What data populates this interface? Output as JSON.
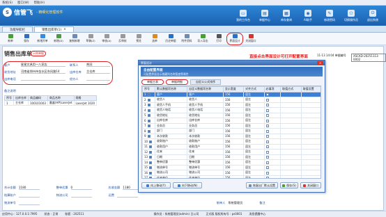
{
  "menu": [
    "系统(S)",
    "窗口(W)",
    "帮助(H)"
  ],
  "brand": {
    "logo_glyph": "S",
    "name": "信管飞",
    "tagline": "- 精细化管理软件"
  },
  "topnav": [
    {
      "label": "我的工作台",
      "glyph": "▭"
    },
    {
      "label": "单据中心",
      "glyph": "▤"
    },
    {
      "label": "库存查询",
      "glyph": "▦"
    },
    {
      "label": "AI助手",
      "glyph": "◉"
    },
    {
      "label": "修改密码",
      "glyph": "✎"
    },
    {
      "label": "切换操作员",
      "glyph": "⚇"
    },
    {
      "label": "退出系统",
      "glyph": "⏻"
    }
  ],
  "doctabs": [
    {
      "label": "功能导航栏",
      "active": false
    },
    {
      "label": "销售出库单(1)",
      "active": true
    }
  ],
  "toolbar": [
    {
      "label": "新单",
      "color": "#4b9c3a"
    },
    {
      "label": "保存",
      "color": "#2f6fbf"
    },
    {
      "label": "新增开单",
      "color": "#3b8ad9"
    },
    {
      "label": "新增(D)",
      "color": "#4b9c3a"
    },
    {
      "label": "复制新增",
      "color": "#6d8bb3"
    },
    {
      "label": "草稿(Z)",
      "color": "#999999"
    },
    {
      "label": "审核(A)",
      "color": "#999999"
    },
    {
      "label": "反审核",
      "color": "#999999"
    },
    {
      "label": "预览",
      "color": "#999999"
    },
    {
      "label": "选单",
      "color": "#e08a1e"
    },
    {
      "label": "历史单据",
      "color": "#2f6fbf"
    },
    {
      "label": "附件资料",
      "color": "#6d8bb3"
    },
    {
      "label": "导入导出",
      "color": "#4b9c3a"
    },
    {
      "label": "打印",
      "color": "#555555"
    },
    {
      "label": "界面设计",
      "color": "#2f6fbf"
    },
    {
      "label": "关闭窗口",
      "color": "#d9342b"
    }
  ],
  "form": {
    "title": "销售出库单",
    "sample_tag": "示例单据",
    "customer_label": "客户",
    "customer_value": "星星文具用一八家店",
    "address_label": "收货地址",
    "address_value": "河南省郑州市金水区东风路14",
    "contact_label": "联系人",
    "contact_value": "胡冠",
    "phone_label": "出库电话",
    "warehouse_label": "出库仓库",
    "warehouse_value": "主仓库",
    "agent_label": "经办人",
    "note_label": "备注说明",
    "lines_headers": [
      "序号",
      "出库仓库",
      "商品编码",
      "商品名称",
      "规格"
    ],
    "lines": [
      [
        "1",
        "主仓库",
        "100101003",
        "墨盒(HP)LaserJet",
        "LaserJet 1020"
      ]
    ]
  },
  "annotation": "直接点击界面设计可打开配置界面",
  "date_text": "11-13 14:04",
  "doc_no_label": "单据编号",
  "doc_no": "XSCKD-20251113-0002",
  "summary": {
    "qty_label": "合计金额",
    "qty_value": "1180",
    "disc_label": "整单优惠",
    "disc_value": "0",
    "paid_label": "应收金额",
    "paid_value": "1180",
    "recv_label": "结算账户",
    "ship_label": "物流公司",
    "trk_label": "物流单号",
    "fee_label": "运费",
    "maker_label": "制单人",
    "maker_value": "系统管理员",
    "remark_label": "备注"
  },
  "status": {
    "ip": "应用中心 : 127.0.0.1:7995",
    "state": "状态 : 正常",
    "count": "账套 : 202511",
    "operator": "操作员 : 系统管理员(admin) 日公司",
    "version": "正式版 版权所有号 : ps0001",
    "online": "消息提醒中心"
  },
  "dialog": {
    "window_title": "界面设计",
    "head_title": "自由配置界面",
    "head_sub": "可配置界面显示隐藏列名称宽度等属性",
    "tabs": [
      {
        "label": "单据主表",
        "selected": true
      },
      {
        "label": "单据明细",
        "selected": true
      },
      {
        "label": "自定义公式排序",
        "selected": false
      }
    ],
    "headers": [
      "序号",
      "默认数据项名称",
      "自定义数据项名称",
      "显示宽度",
      "对齐方式",
      "必填项",
      "取值方式",
      "取值设置"
    ],
    "rows": [
      [
        "1",
        "客户",
        "客户",
        "156",
        "居左"
      ],
      [
        "2",
        "收货人",
        "收货人",
        "156",
        "居左"
      ],
      [
        "3",
        "收货人手机",
        "收货人手机",
        "156",
        "居左"
      ],
      [
        "4",
        "收货人电话",
        "收货人电话",
        "156",
        "居左"
      ],
      [
        "5",
        "收货地址",
        "收货地址",
        "156",
        "居左"
      ],
      [
        "6",
        "出库仓库",
        "出库仓库",
        "156",
        "居左"
      ],
      [
        "7",
        "业务员",
        "业务员",
        "156",
        "居左"
      ],
      [
        "8",
        "部门",
        "部门",
        "156",
        "居左"
      ],
      [
        "9",
        "本次收款",
        "本次收款",
        "156",
        "居左"
      ],
      [
        "10",
        "收款账户",
        "收款账户",
        "156",
        "居左"
      ],
      [
        "11",
        "收款用户",
        "收款用户",
        "156",
        "居左"
      ],
      [
        "12",
        "往来",
        "往来",
        "156",
        "居左"
      ],
      [
        "13",
        "日期",
        "日期",
        "156",
        "居左"
      ],
      [
        "14",
        "整单优惠",
        "整单优惠",
        "156",
        "居左"
      ],
      [
        "15",
        "物流单号",
        "物流单号",
        "156",
        "居左"
      ],
      [
        "16",
        "物流公司",
        "物流公司",
        "156",
        "居左"
      ],
      [
        "17",
        "往来单位",
        "往来单位",
        "156",
        "居左"
      ]
    ],
    "btn_up": "向上移动(Y)",
    "btn_down": "向下移动(N)",
    "btn_reset": "恢复出厂默认设置",
    "btn_save": "保存(S)",
    "btn_close": "关闭窗口"
  }
}
